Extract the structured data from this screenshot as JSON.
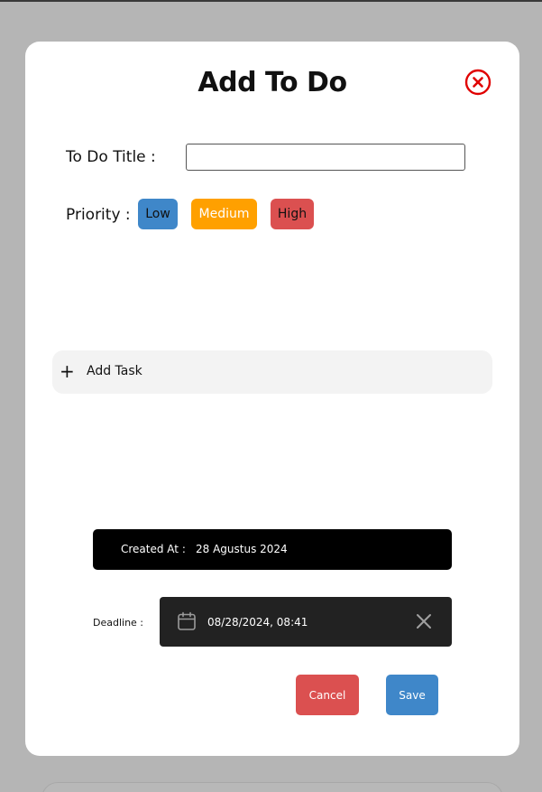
{
  "modal": {
    "title": "Add To Do",
    "close_icon": "close-circle-icon"
  },
  "form": {
    "title_label": "To Do Title :",
    "title_value": "",
    "priority_label": "Priority :",
    "priorities": [
      {
        "label": "Low",
        "color": "#3f87c9"
      },
      {
        "label": "Medium",
        "color": "#ffa000"
      },
      {
        "label": "High",
        "color": "#db5050"
      }
    ]
  },
  "tasks": {
    "add_icon": "plus-icon",
    "add_label": "Add Task"
  },
  "meta": {
    "created_label": "Created At :",
    "created_value": "28 Agustus 2024",
    "deadline_label": "Deadline :",
    "deadline_value": "08/28/2024, 08:41",
    "deadline_icon": "calendar-icon",
    "clear_icon": "clear-x-icon"
  },
  "actions": {
    "cancel_label": "Cancel",
    "save_label": "Save",
    "cancel_color": "#db5050",
    "save_color": "#3f87c9"
  }
}
